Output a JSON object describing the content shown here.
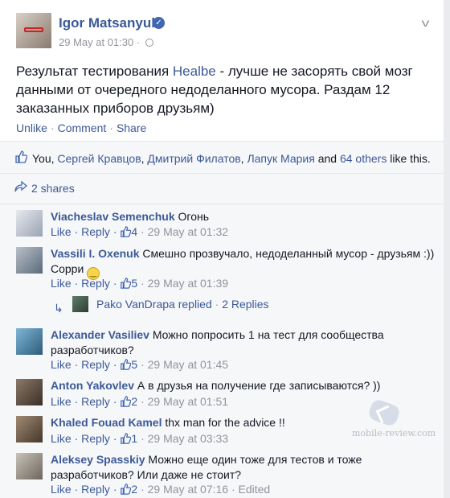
{
  "post": {
    "author": "Igor Matsanyuk",
    "date": "29 May at 01:30",
    "separator": "·",
    "text_before": "Результат тестирования ",
    "text_link": "Healbe",
    "text_after": " - лучше не засорять свой мозг данными от очередного недоделанного мусора. Раздам 12 заказанных приборов друзьям)",
    "actions": {
      "unlike": "Unlike",
      "comment": "Comment",
      "share": "Share"
    }
  },
  "likes": {
    "you": "You",
    "names": [
      "Сергей Кравцов",
      "Дмитрий Филатов",
      "Лапук Мария"
    ],
    "and_text": "and",
    "others": "64 others",
    "suffix": "like this."
  },
  "shares": {
    "label": "2 shares"
  },
  "comments": [
    {
      "name": "Viacheslav Semenchuk",
      "text": "Огонь",
      "like": "Like",
      "reply": "Reply",
      "count": "4",
      "time": "29 May at 01:32"
    },
    {
      "name": "Vassili I. Oxenuk",
      "text": "Смешно прозвучало, недоделанный мусор - друзьям :)) Сорри",
      "like": "Like",
      "reply": "Reply",
      "count": "5",
      "time": "29 May at 01:39"
    },
    {
      "name": "Alexander Vasiliev",
      "text": "Можно попросить 1 на тест для сообщества разработчиков?",
      "like": "Like",
      "reply": "Reply",
      "count": "5",
      "time": "29 May at 01:45"
    },
    {
      "name": "Anton Yakovlev",
      "text": "А в друзья на получение где записываются? ))",
      "like": "Like",
      "reply": "Reply",
      "count": "2",
      "time": "29 May at 01:51"
    },
    {
      "name": "Khaled Fouad Kamel",
      "text": "thx man for the advice !!",
      "like": "Like",
      "reply": "Reply",
      "count": "1",
      "time": "29 May at 03:33"
    },
    {
      "name": "Aleksey Spasskiy",
      "text": "Можно еще один тоже для тестов и тоже разработчиков? Или даже не стоит?",
      "like": "Like",
      "reply": "Reply",
      "count": "2",
      "time": "29 May at 07:16",
      "edited": "Edited"
    }
  ],
  "reply_summary": {
    "name": "Pako VanDrapa",
    "text": "replied",
    "sep": "·",
    "count": "2 Replies"
  },
  "watermark": "mobile-review.com",
  "colors": {
    "link": "#3b5998",
    "muted": "#90949c",
    "bg": "#f6f7f9"
  }
}
